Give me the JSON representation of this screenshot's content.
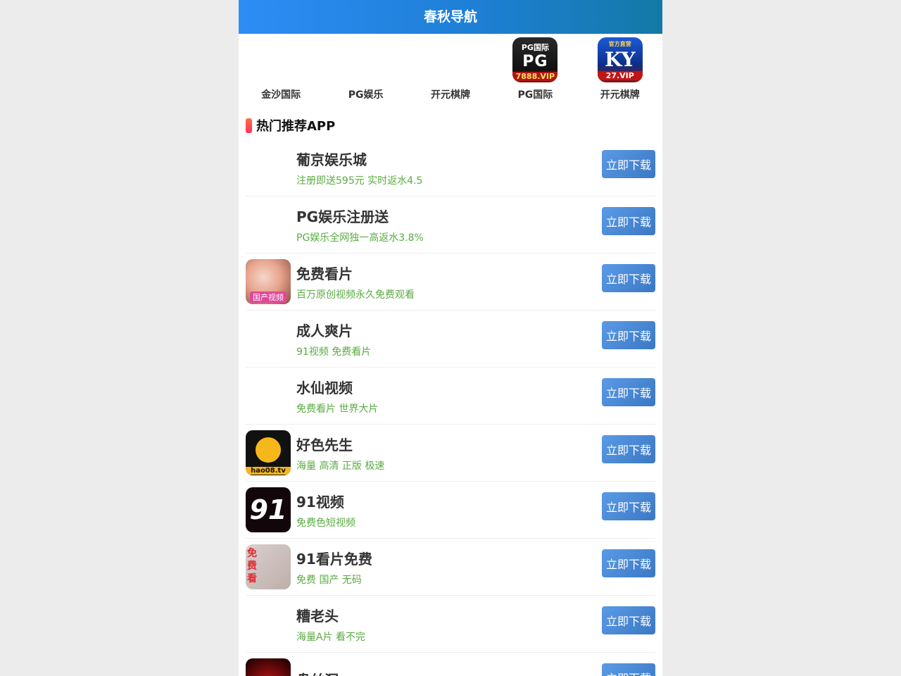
{
  "header": {
    "title": "春秋导航"
  },
  "nav": [
    {
      "label": "金沙国际",
      "icon": "blank"
    },
    {
      "label": "PG娱乐",
      "icon": "blank"
    },
    {
      "label": "开元棋牌",
      "icon": "blank"
    },
    {
      "label": "PG国际",
      "icon": "pg-logo-icon",
      "icon_text_top": "PG国际",
      "icon_text_mid": "PG",
      "icon_text_bottom": "7888.VIP"
    },
    {
      "label": "开元棋牌",
      "icon": "ky-logo-icon",
      "icon_text_top": "官方直营",
      "icon_text_mid": "KY",
      "icon_text_bottom": "27.VIP"
    }
  ],
  "section": {
    "title": "热门推荐APP"
  },
  "button_label": "立即下载",
  "apps": [
    {
      "name": "葡京娱乐城",
      "desc": "注册即送595元 实时返水4.5",
      "icon": "blank"
    },
    {
      "name": "PG娱乐注册送",
      "desc": "PG娱乐全网独一高返水3.8%",
      "icon": "blank"
    },
    {
      "name": "免费看片",
      "desc": "百万原创视频永久免费观看",
      "icon": "girl-photo-icon",
      "icon_caption": "国产视频"
    },
    {
      "name": "成人爽片",
      "desc": "91视频 免费看片",
      "icon": "blank"
    },
    {
      "name": "水仙视频",
      "desc": "免费看片 世界大片",
      "icon": "blank"
    },
    {
      "name": "好色先生",
      "desc": "海量 高清 正版 极速",
      "icon": "hao-logo-icon",
      "icon_caption": "hao08.tv"
    },
    {
      "name": "91视频",
      "desc": "免费色短视频",
      "icon": "91-logo-icon",
      "icon_caption": "91"
    },
    {
      "name": "91看片免费",
      "desc": "免费 国产 无码",
      "icon": "free-watch-icon",
      "icon_caption": "免费看"
    },
    {
      "name": "糟老头",
      "desc": "海量A片 看不完",
      "icon": "blank"
    },
    {
      "name": "盘丝洞",
      "desc": "",
      "icon": "red-photo-icon"
    }
  ]
}
